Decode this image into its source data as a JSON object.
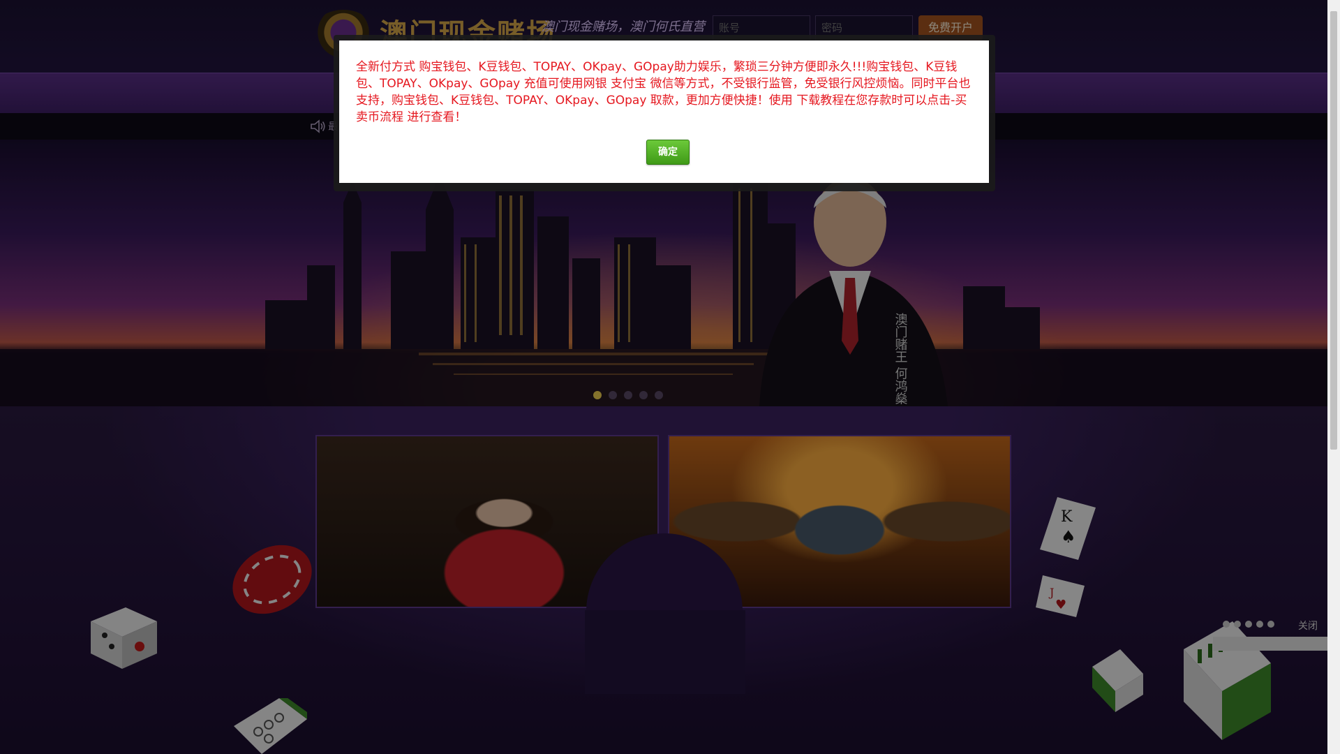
{
  "header": {
    "logo_title": "澳门现金赌场",
    "logo_slogan": "澳门现金赌场，澳门何氏直营",
    "username_placeholder": "账号",
    "password_placeholder": "密码",
    "register_label": "免费开户"
  },
  "notice": {
    "text": "最"
  },
  "banner": {
    "person_caption": "澳门赌王 何鸿燊",
    "slide_count": 5,
    "active_slide": 1
  },
  "modal": {
    "message": "全新付方式 购宝钱包、K豆钱包、TOPAY、OKpay、GOpay助力娱乐，繁琐三分钟方便即永久!!!购宝钱包、K豆钱包、TOPAY、OKpay、GOpay 充值可使用网银 支付宝 微信等方式，不受银行监管，免受银行风控烦恼。同时平台也支持，购宝钱包、K豆钱包、TOPAY、OKpay、GOpay 取款，更加方便快捷！使用 下载教程在您存款时可以点击-买卖币流程 进行查看！",
    "ok_label": "确定"
  },
  "floating": {
    "close_label": "关闭",
    "dot_count": 5
  },
  "colors": {
    "modal_text": "#e5171f",
    "ok_button": "#4fae22",
    "nav_purple": "#5a2f88",
    "register_button": "#a6551f"
  }
}
